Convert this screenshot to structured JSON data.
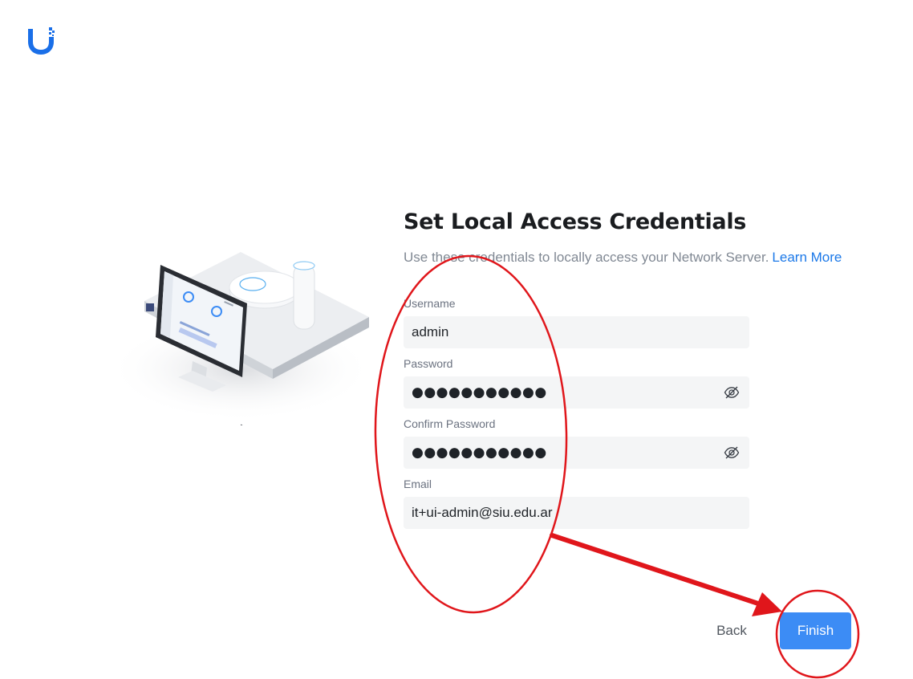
{
  "brand": {
    "logo_icon": "ubiquiti-u-icon",
    "accent": "#1a6fe8"
  },
  "page": {
    "title": "Set Local Access Credentials",
    "subtitle": "Use these credentials to locally access your Network Server.",
    "learn_more": "Learn More"
  },
  "form": {
    "username": {
      "label": "Username",
      "value": "admin"
    },
    "password": {
      "label": "Password",
      "value": "●●●●●●●●●●●",
      "toggle_icon": "eye-slash-icon"
    },
    "confirm_password": {
      "label": "Confirm Password",
      "value": "●●●●●●●●●●●",
      "toggle_icon": "eye-slash-icon"
    },
    "email": {
      "label": "Email",
      "value": "it+ui-admin@siu.edu.ar"
    }
  },
  "actions": {
    "back": "Back",
    "finish": "Finish",
    "finish_color": "#3c8cf5"
  },
  "annotations": {
    "color": "#e0161b"
  }
}
